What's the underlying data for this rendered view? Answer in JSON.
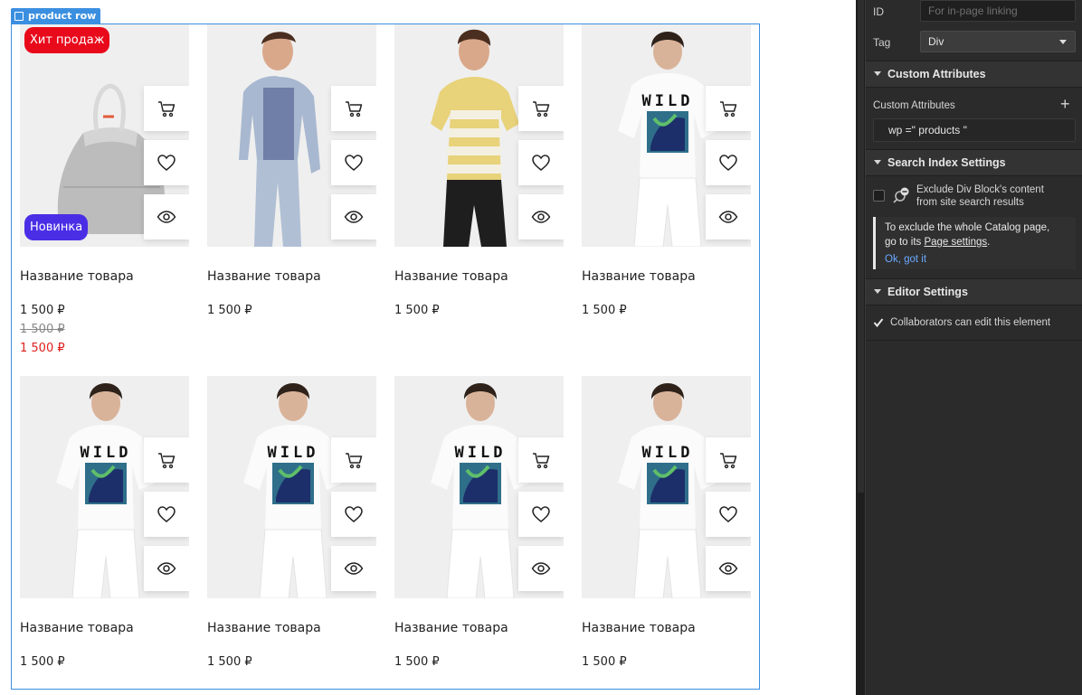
{
  "canvas": {
    "selection_label": "product row",
    "products": [
      {
        "name": "Название товара",
        "prices": [
          "1 500 ₽",
          "1 500 ₽",
          "1 500 ₽"
        ],
        "badges": [
          "Хит продаж",
          "Новинка"
        ],
        "image": "backpack"
      },
      {
        "name": "Название товара",
        "prices": [
          "1 500 ₽"
        ],
        "image": "man-blazer"
      },
      {
        "name": "Название товара",
        "prices": [
          "1 500 ₽"
        ],
        "image": "man-striped-tee"
      },
      {
        "name": "Название товара",
        "prices": [
          "1 500 ₽"
        ],
        "image": "wild-tee"
      },
      {
        "name": "Название товара",
        "prices": [
          "1 500 ₽"
        ],
        "image": "wild-tee"
      },
      {
        "name": "Название товара",
        "prices": [
          "1 500 ₽"
        ],
        "image": "wild-tee"
      },
      {
        "name": "Название товара",
        "prices": [
          "1 500 ₽"
        ],
        "image": "wild-tee"
      },
      {
        "name": "Название товара",
        "prices": [
          "1 500 ₽"
        ],
        "image": "wild-tee"
      }
    ],
    "tee_print": "WILD",
    "actions": [
      "cart-icon",
      "heart-icon",
      "eye-icon"
    ]
  },
  "panel": {
    "id_label": "ID",
    "id_placeholder": "For in-page linking",
    "tag_label": "Tag",
    "tag_value": "Div",
    "custom_attributes": {
      "header": "Custom Attributes",
      "label": "Custom Attributes",
      "add": "+",
      "value": "wp =\" products \""
    },
    "search_index": {
      "header": "Search Index Settings",
      "exclude_line1": "Exclude Div Block's content",
      "exclude_line2": "from site search results",
      "note_line1": "To exclude the whole Catalog page,",
      "note_line2_pre": "go to its ",
      "note_link": "Page settings",
      "note_line2_post": ".",
      "ok": "Ok, got it"
    },
    "editor": {
      "header": "Editor Settings",
      "collab": "Collaborators can edit this element"
    }
  }
}
